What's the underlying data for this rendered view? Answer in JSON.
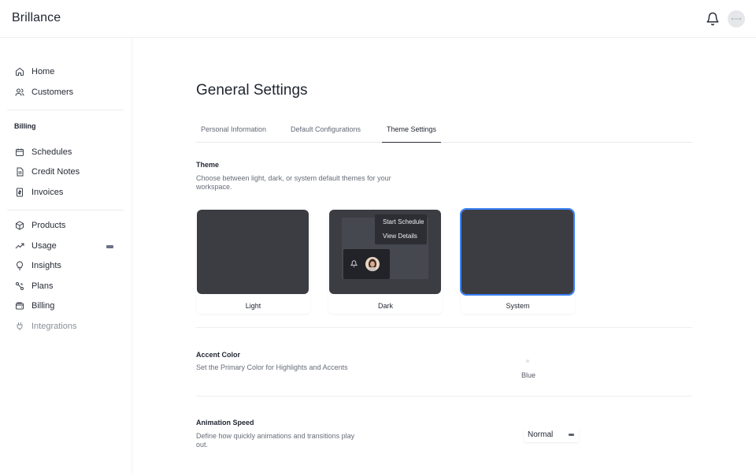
{
  "app": {
    "brand": "Brillance"
  },
  "sidebar": {
    "home": "Home",
    "customers": "Customers",
    "billing_section": "Billing",
    "schedules": "Schedules",
    "credit_notes": "Credit Notes",
    "invoices": "Invoices",
    "products": "Products",
    "usage": "Usage",
    "insights": "Insights",
    "plans": "Plans",
    "billing": "Billing",
    "integrations": "Integrations"
  },
  "page": {
    "title": "General Settings",
    "tabs": [
      "Personal Information",
      "Default Configurations",
      "Theme Settings"
    ],
    "active_tab": "Theme Settings"
  },
  "theme": {
    "title": "Theme",
    "description_line1": "Choose between light, dark, or system default themes for your",
    "description_line2": "workspace.",
    "options": [
      "Light",
      "Dark",
      "System"
    ],
    "selected": "System",
    "dark_preview": {
      "menu_items": [
        "Start Schedule",
        "View Details"
      ]
    }
  },
  "accent": {
    "title": "Accent Color",
    "description": "Set the Primary Color for Highlights and Accents",
    "value": "Blue"
  },
  "animation": {
    "title": "Animation Speed",
    "description_line1": "Define how quickly animations and transitions play",
    "description_line2": "out.",
    "value": "Normal"
  },
  "colors": {
    "selected_outline": "#3b82f6",
    "preview_bg": "#3c3d43"
  }
}
